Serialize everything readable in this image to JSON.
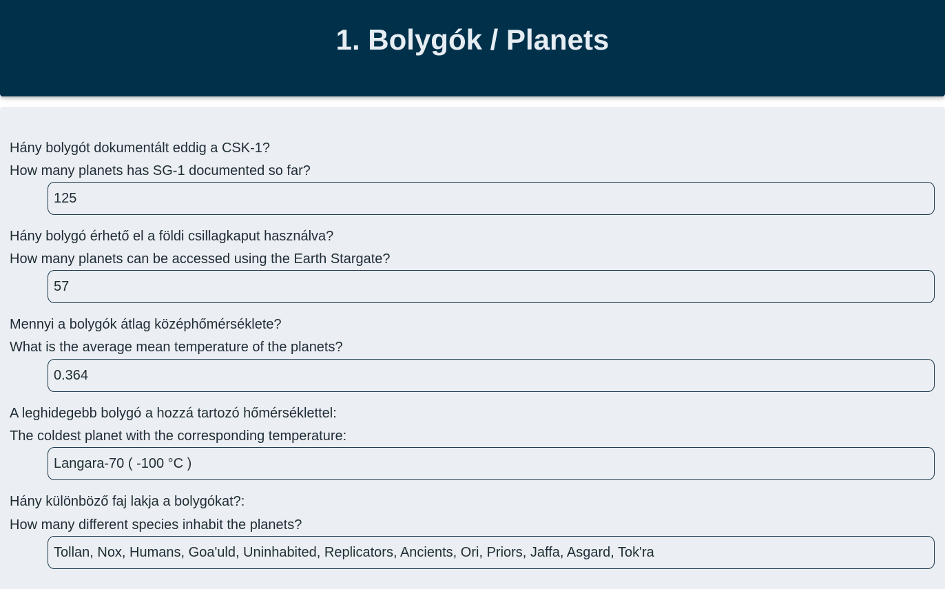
{
  "header": {
    "title": "1. Bolygók / Planets"
  },
  "questions": [
    {
      "hu": "Hány bolygót dokumentált eddig a CSK-1?",
      "en": "How many planets has SG-1 documented so far?",
      "answer": "125"
    },
    {
      "hu": "Hány bolygó érhető el a földi csillagkaput használva?",
      "en": "How many planets can be accessed using the Earth Stargate?",
      "answer": "57"
    },
    {
      "hu": "Mennyi a bolygók átlag középhőmérséklete?",
      "en": "What is the average mean temperature of the planets?",
      "answer": "0.364"
    },
    {
      "hu": "A leghidegebb bolygó a hozzá tartozó hőmérséklettel:",
      "en": "The coldest planet with the corresponding temperature:",
      "answer": "Langara-70 ( -100 °C )"
    },
    {
      "hu": "Hány különböző faj lakja a bolygókat?:",
      "en": "How many different species inhabit the planets?",
      "answer": "Tollan, Nox, Humans, Goa'uld, Uninhabited, Replicators, Ancients, Ori, Priors, Jaffa, Asgard, Tok'ra"
    }
  ]
}
